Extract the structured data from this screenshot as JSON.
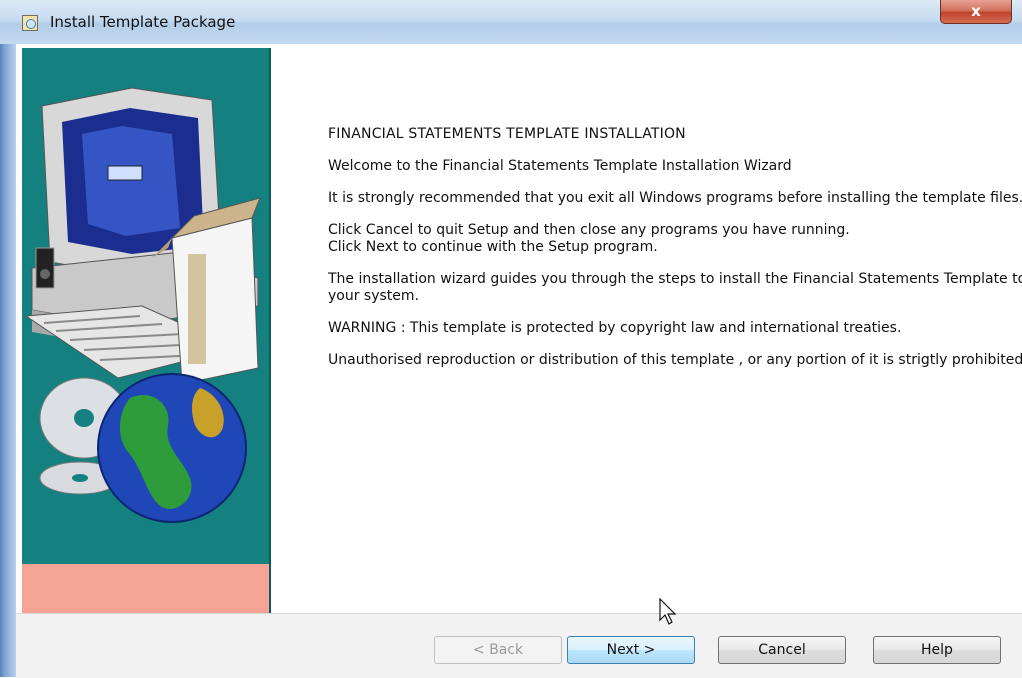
{
  "window": {
    "title": "Install Template Package",
    "close_label": "x"
  },
  "content": {
    "heading": "FINANCIAL STATEMENTS TEMPLATE INSTALLATION",
    "welcome": "Welcome to the Financial Statements Template Installation Wizard",
    "paragraph1": "It is strongly recommended that you exit all Windows programs before installing the template files.",
    "paragraph2_line1": "Click Cancel to quit Setup and then close any programs you have running.",
    "paragraph2_line2": "Click Next to continue with the Setup program.",
    "paragraph3": "The installation wizard guides you through the steps to install the Financial Statements Template to your system.",
    "warning": "WARNING : This template is protected by copyright law and international treaties.",
    "paragraph4": "Unauthorised reproduction or distribution of this template , or any portion of it is strigtly prohibited."
  },
  "buttons": {
    "back": "< Back",
    "next": "Next >",
    "cancel": "Cancel",
    "help": "Help"
  },
  "colors": {
    "side_panel": "#148080",
    "side_panel_footer": "#f4a395",
    "close_button": "#c1432b"
  },
  "icons": [
    "installer-window-icon",
    "computer-illustration",
    "globe-illustration",
    "cd-disc-illustration",
    "mouse-pointer-icon"
  ]
}
